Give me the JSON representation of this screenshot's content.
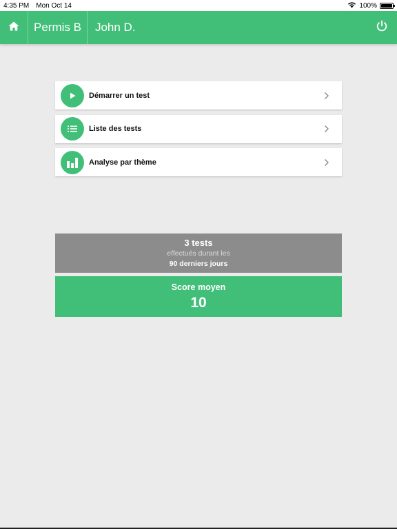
{
  "status_bar": {
    "time": "4:35 PM",
    "date": "Mon Oct 14",
    "battery": "100%",
    "battery_level": 1.0,
    "wifi_icon": "wifi-icon",
    "battery_icon": "battery-icon"
  },
  "navbar": {
    "home_icon": "home-icon",
    "section": "Permis B",
    "user": "John D.",
    "power_icon": "power-icon",
    "background_color": "#41bf79"
  },
  "menu": {
    "items": [
      {
        "label": "Démarrer un test",
        "icon": "play-icon"
      },
      {
        "label": "Liste des tests",
        "icon": "list-icon"
      },
      {
        "label": "Analyse par thème",
        "icon": "bar-chart-icon"
      }
    ],
    "accent_color": "#41bf79"
  },
  "stats": {
    "count": "3 tests",
    "description": "effectués durant les",
    "period": "90 derniers jours",
    "background_color": "#8c8c8c"
  },
  "score": {
    "label": "Score moyen",
    "value": "10",
    "background_color": "#41bf79"
  }
}
